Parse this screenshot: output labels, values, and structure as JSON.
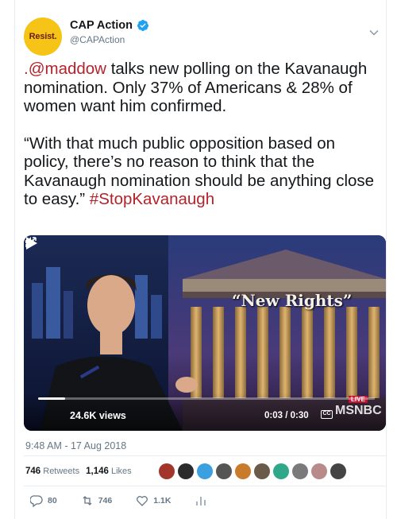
{
  "author": {
    "avatar_text": "Resist.",
    "display_name": "CAP Action",
    "handle": "@CAPAction",
    "avatar_color": "#f5c417",
    "verified": true
  },
  "tweet": {
    "paragraph1_link": ".@maddow",
    "paragraph1_text": " talks new polling on the Kavanaugh nomination. Only 37% of Americans & 28% of women want him confirmed.",
    "paragraph2_text": "“With that much public opposition based on policy, there’s no reason to think that the Kavanaugh nomination should be anything close to easy.” ",
    "paragraph2_hashtag": "#StopKavanaugh",
    "link_color": "#b3232a"
  },
  "media": {
    "chyron": "“New Rights”",
    "views": "24.6K views",
    "time": "0:03 / 0:30",
    "live_badge": "LIVE",
    "network_logo": "MSNBC",
    "cc_label": "CC",
    "progress": 0.08
  },
  "timestamp": "9:48 AM - 17 Aug 2018",
  "stats": {
    "retweets_count": "746",
    "retweets_label": "Retweets",
    "likes_count": "1,146",
    "likes_label": "Likes"
  },
  "likers": [
    "#a3362a",
    "#2b2b2b",
    "#3aa0e0",
    "#555555",
    "#c77b2b",
    "#6a5a4a",
    "#2fa88a",
    "#7a7a7a",
    "#b88a8a",
    "#444444"
  ],
  "actions": {
    "replies": "80",
    "retweets": "746",
    "likes": "1.1K"
  }
}
